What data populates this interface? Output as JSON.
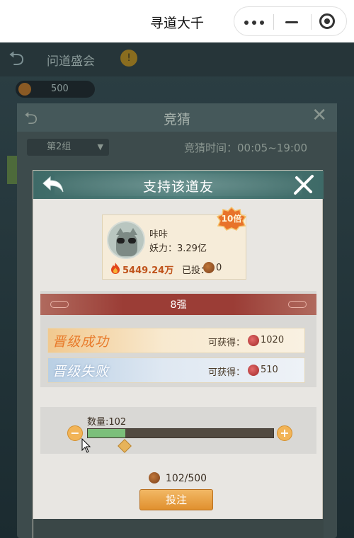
{
  "topbar": {
    "title": "寻道大千",
    "more_icon": "more-dots-icon",
    "minimize_icon": "minimize-icon",
    "close_icon": "target-close-icon"
  },
  "game_bg": {
    "title": "问道盛会",
    "banner": "问道盛会",
    "coins": "500",
    "quiz_title": "竞猜",
    "group": "第2组",
    "quiz_time": "竞猜时间：00:05~19:00"
  },
  "modal": {
    "title": "支持该道友",
    "player": {
      "name": "咔咔",
      "power": "妖力：3.29亿",
      "multiplier": "10倍",
      "heat": "5449.24万",
      "bet_label": "已投：",
      "bet_value": "0"
    },
    "rank": "8强",
    "options": [
      {
        "title": "晋级成功",
        "gain_label": "可获得：",
        "value": "1020"
      },
      {
        "title": "晋级失败",
        "gain_label": "可获得：",
        "value": "510"
      }
    ],
    "quantity": {
      "label": "数量:102",
      "minus": "−",
      "plus": "+",
      "value": 102,
      "max": 500
    },
    "total": "102/500",
    "bet_button": "投注"
  },
  "colors": {
    "accent": "#e0902e",
    "header": "#4e7d7a",
    "rank": "#9b3d36",
    "slider_fill": "#7bbf7a"
  }
}
